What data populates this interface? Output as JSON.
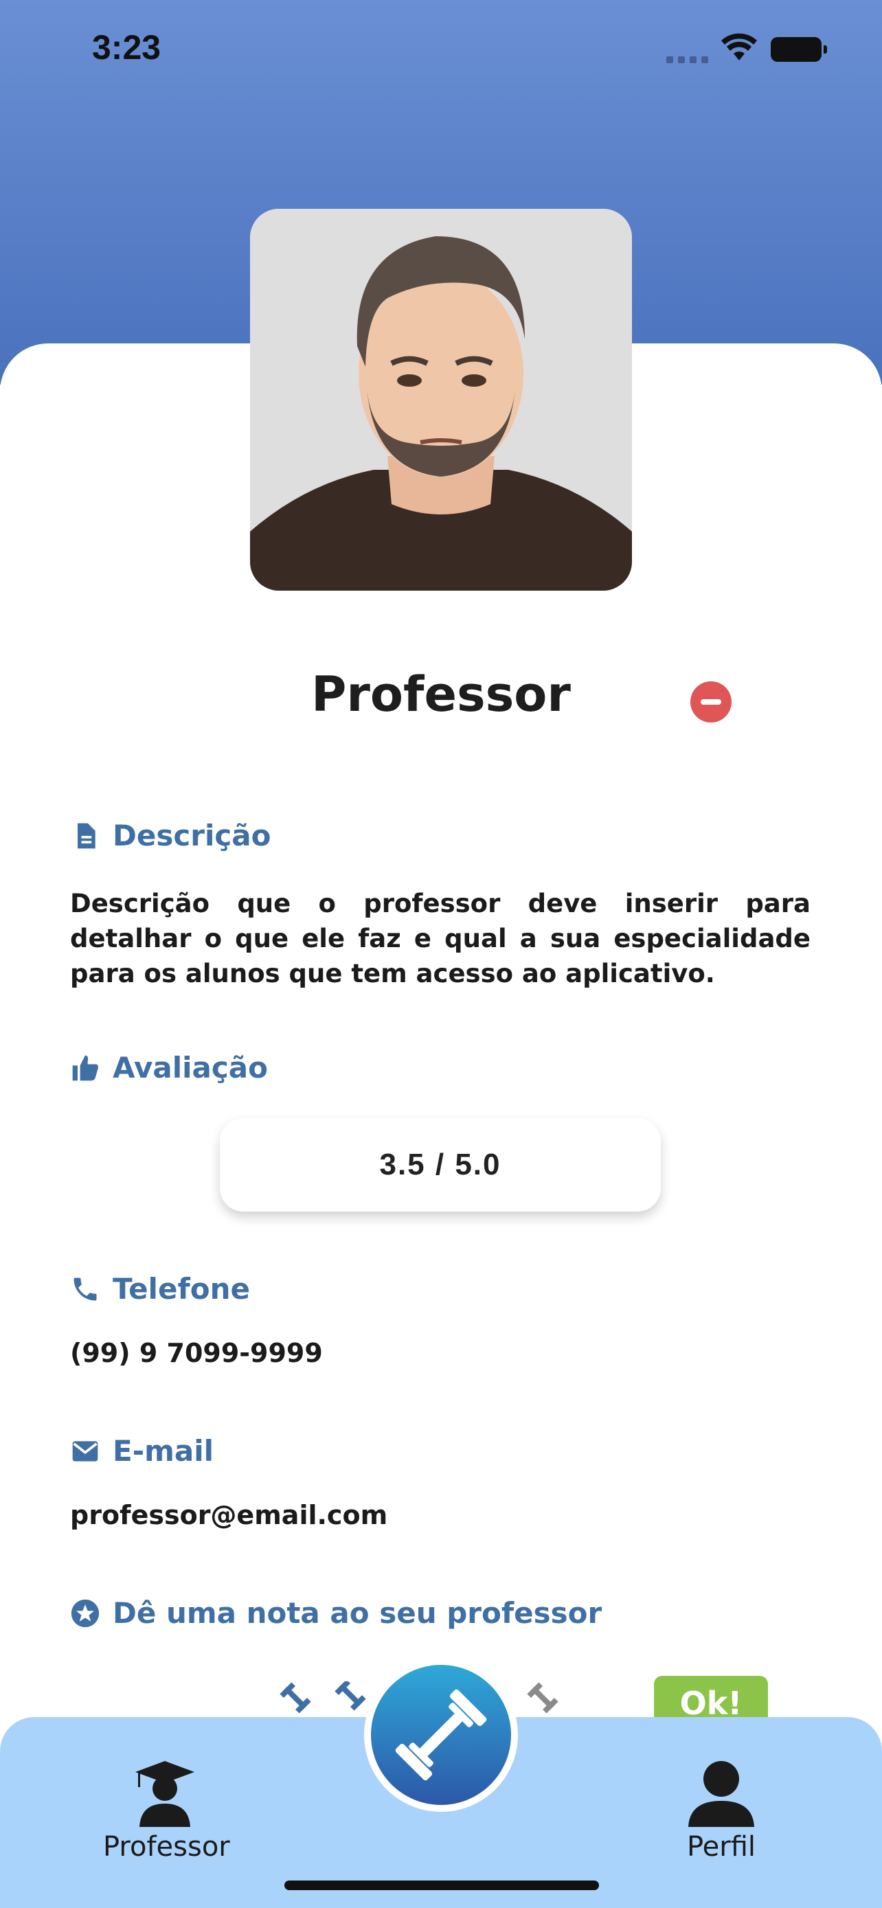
{
  "status_bar": {
    "time": "3:23"
  },
  "profile": {
    "name": "Professor",
    "description_title": "Descrição",
    "description": "Descrição que o professor deve inserir para detalhar o que ele faz e qual a sua especialidade para os alunos que tem acesso ao aplicativo.",
    "rating_title": "Avaliação",
    "rating_value": "3.5 / 5.0",
    "phone_title": "Telefone",
    "phone": "(99) 9 7099-9999",
    "email_title": "E-mail",
    "email": "professor@email.com",
    "rate_title": "Dê uma nota ao seu professor",
    "ok_label": "Ok!"
  },
  "tabbar": {
    "left_label": "Professor",
    "right_label": "Perfil"
  },
  "colors": {
    "header": "#4a72bd",
    "accent": "#3f6fa4",
    "remove": "#e05556",
    "ok": "#8cc44a",
    "tabbar": "#aad3fb"
  },
  "icons": {
    "description": "document-icon",
    "rating": "thumbs-up-icon",
    "phone": "phone-icon",
    "email": "mail-icon",
    "rate": "star-circle-icon",
    "center": "dumbbell-icon",
    "left_tab": "graduate-icon",
    "right_tab": "user-icon"
  }
}
